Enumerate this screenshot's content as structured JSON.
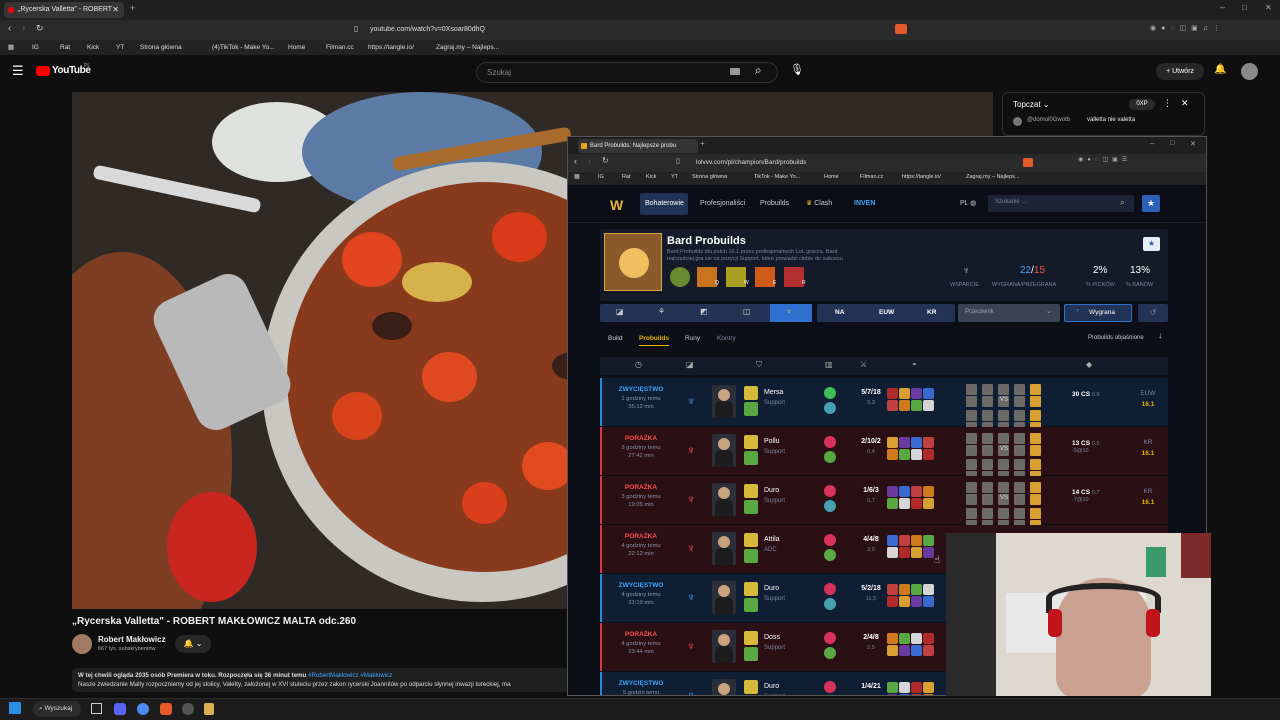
{
  "outer_browser": {
    "tab_title": "„Rycerska Valletta\" - ROBERT",
    "url": "youtube.com/watch?v=0Xsoar80dhQ",
    "bookmarks": [
      "IG",
      "Rat",
      "Kick",
      "YT",
      "Strona główna",
      "(4)TikTok - Make Yo...",
      "Home",
      "Filman.cc",
      "https://tangle.io/",
      "Zagraj.my – Najleps..."
    ]
  },
  "youtube": {
    "logo": "YouTube",
    "logo_sup": "PL",
    "search_placeholder": "Szukaj",
    "create_label": "Utwórz",
    "video_title": "„Rycerska Valletta\" - ROBERT MAKŁOWICZ MALTA odc.260",
    "channel_name": "Robert Makłowicz",
    "subscribers": "667 tys. subskrybentów",
    "description_line1": "W tej chwili ogląda 2035 osób  Premiera w toku. Rozpoczęła się 36 minut temu",
    "description_tags": "#RobertMakłowicz #Makłowicz",
    "description_line2": "Nasze zwiedzanie Malty rozpoczniemy od jej stolicy, Valetty, założonej w XVI stuleciu przez zakon rycerski Joannitów po odparciu słynnej inwazji tureckiej, ma"
  },
  "topchat": {
    "title": "Topczat",
    "xp": "0XP",
    "message_user": "@domol0Gwotb",
    "message_text": "valletta nie valetta"
  },
  "inner_browser": {
    "tab_title": "Bard Probuilds: Najlepsze probu",
    "url": "lolvvv.com/pl/champion/Bard/probuilds",
    "bookmarks": [
      "IG",
      "Rat",
      "Kick",
      "YT",
      "Strona główna",
      "TikTok - Make Yo...",
      "Home",
      "Filman.cc",
      "https://tangle.io/",
      "Zagraj.my – Najleps..."
    ]
  },
  "site": {
    "nav": [
      "Bohaterowie",
      "Profesjonaliści",
      "Probuilds",
      "Clash",
      "INVEN"
    ],
    "lang": "PL",
    "search_placeholder": "Szukanie ...",
    "champ_name": "Bard Probuilds",
    "champ_desc": "Bard Probuilds dla patch 16.1 przez profesjonalnych LoL gracza. Bard najczęściej gra sie na pozycji Support, które prowadzi ciebie do sukcesu.",
    "ability_keys": [
      "Q",
      "W",
      "E",
      "R"
    ],
    "stat_role_label": "WSPARCIE",
    "stat_wins": "22",
    "stat_losses": "15",
    "stat_wr_label": "WYGRANA/PRZEGRANA",
    "stat_pick": "2%",
    "stat_pick_label": "% PICKÓW",
    "stat_ban": "13%",
    "stat_ban_label": "% BANÓW",
    "regions": [
      "NA",
      "EUW",
      "KR"
    ],
    "opponent_placeholder": "Przeciwnik",
    "win_filter": "Wygrana",
    "tabs": [
      "Build",
      "Probuilds",
      "Runy",
      "Kontry"
    ],
    "explained": "Probuilds objaśnione",
    "rows": [
      {
        "result": "ZWYCIĘSTWO",
        "win": true,
        "ago": "1 godziny temu",
        "dur": "35:12 min",
        "name": "Mersa",
        "role": "Support",
        "kda": "5/7/18",
        "ratio": "3,3",
        "cs": "30 CS",
        "csm": "0.9",
        "csd": "",
        "region": "EUW",
        "patch": "16.1"
      },
      {
        "result": "PORAŻKA",
        "win": false,
        "ago": "3 godziny temu",
        "dur": "27:42 min",
        "name": "Pollu",
        "role": "Support",
        "kda": "2/10/2",
        "ratio": "0,4",
        "cs": "13 CS",
        "csm": "0.5",
        "csd": "-5@10",
        "region": "KR",
        "patch": "16.1"
      },
      {
        "result": "PORAŻKA",
        "win": false,
        "ago": "3 godziny temu",
        "dur": "19:05 min",
        "name": "Duro",
        "role": "Support",
        "kda": "1/6/3",
        "ratio": "0,7",
        "cs": "14 CS",
        "csm": "0.7",
        "csd": "-7@10",
        "region": "KR",
        "patch": "16.1"
      },
      {
        "result": "PORAŻKA",
        "win": false,
        "ago": "4 godziny temu",
        "dur": "22:12 min",
        "name": "Attila",
        "role": "ADC",
        "kda": "4/4/8",
        "ratio": "3,0",
        "cs": "",
        "csm": "",
        "csd": "",
        "region": "",
        "patch": ""
      },
      {
        "result": "ZWYCIĘSTWO",
        "win": true,
        "ago": "4 godziny temu",
        "dur": "31:19 min",
        "name": "Duro",
        "role": "Support",
        "kda": "5/2/18",
        "ratio": "11,5",
        "cs": "",
        "csm": "",
        "csd": "",
        "region": "",
        "patch": ""
      },
      {
        "result": "PORAŻKA",
        "win": false,
        "ago": "4 godziny temu",
        "dur": "23:44 min",
        "name": "Doss",
        "role": "Support",
        "kda": "2/4/8",
        "ratio": "2,5",
        "cs": "",
        "csm": "",
        "csd": "",
        "region": "",
        "patch": ""
      },
      {
        "result": "ZWYCIĘSTWO",
        "win": true,
        "ago": "5 godzin temu",
        "dur": "",
        "name": "Duro",
        "role": "Support",
        "kda": "1/4/21",
        "ratio": "",
        "cs": "",
        "csm": "",
        "csd": "",
        "region": "",
        "patch": ""
      }
    ]
  },
  "taskbar": {
    "search": "Wyszukaj"
  },
  "colors": {
    "win": "#2e88d8",
    "lose": "#d33a3a",
    "accent": "#3fa4ff",
    "gold": "#e6b800"
  }
}
